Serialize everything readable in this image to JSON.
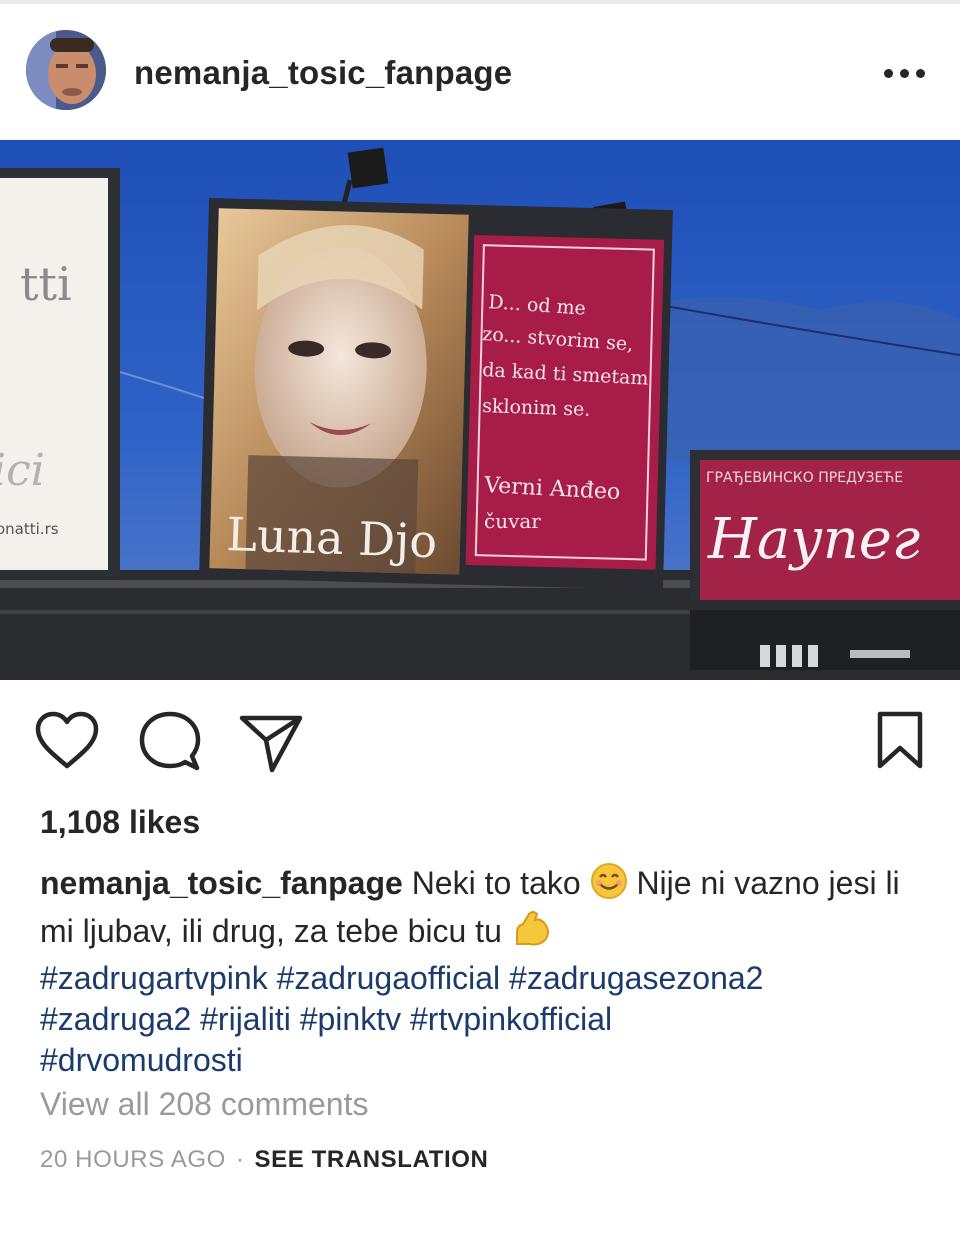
{
  "post": {
    "username": "nemanja_tosic_fanpage",
    "more_icon": "more-horizontal-icon",
    "photo": {
      "billboard_name": "Luna Djo",
      "billboard_poem": [
        "D... od me",
        "zo... stvorim se,",
        "da kad ti smetam",
        "sklonim se."
      ],
      "billboard_signature": [
        "Verni Anđeo",
        "čuvar"
      ],
      "right_sign_small": "ГРАЂЕВИНСКО ПРЕДУЗЕЋЕ",
      "right_sign_big": "Наупег",
      "left_sign_text": [
        "tti",
        "ici",
        "onatti.rs"
      ]
    },
    "actions": {
      "like_icon": "heart-icon",
      "comment_icon": "comment-icon",
      "share_icon": "send-icon",
      "save_icon": "bookmark-icon"
    },
    "likes": "1,108 likes",
    "caption": {
      "username": "nemanja_tosic_fanpage",
      "text_part1": "Neki to tako",
      "text_part2": "Nije ni vazno jesi li mi ljubav, ili drug, za tebe bicu tu",
      "hashtags_line1": "#zadrugartvpink #zadrugaofficial #zadrugasezona2",
      "hashtags_line2": "#zadruga2 #rijaliti #pinktv #rtvpinkofficial",
      "hashtags_line3": "#drvomudrosti"
    },
    "view_comments": "View all 208 comments",
    "timestamp": "20 HOURS AGO",
    "separator": "·",
    "see_translation": "SEE TRANSLATION"
  }
}
